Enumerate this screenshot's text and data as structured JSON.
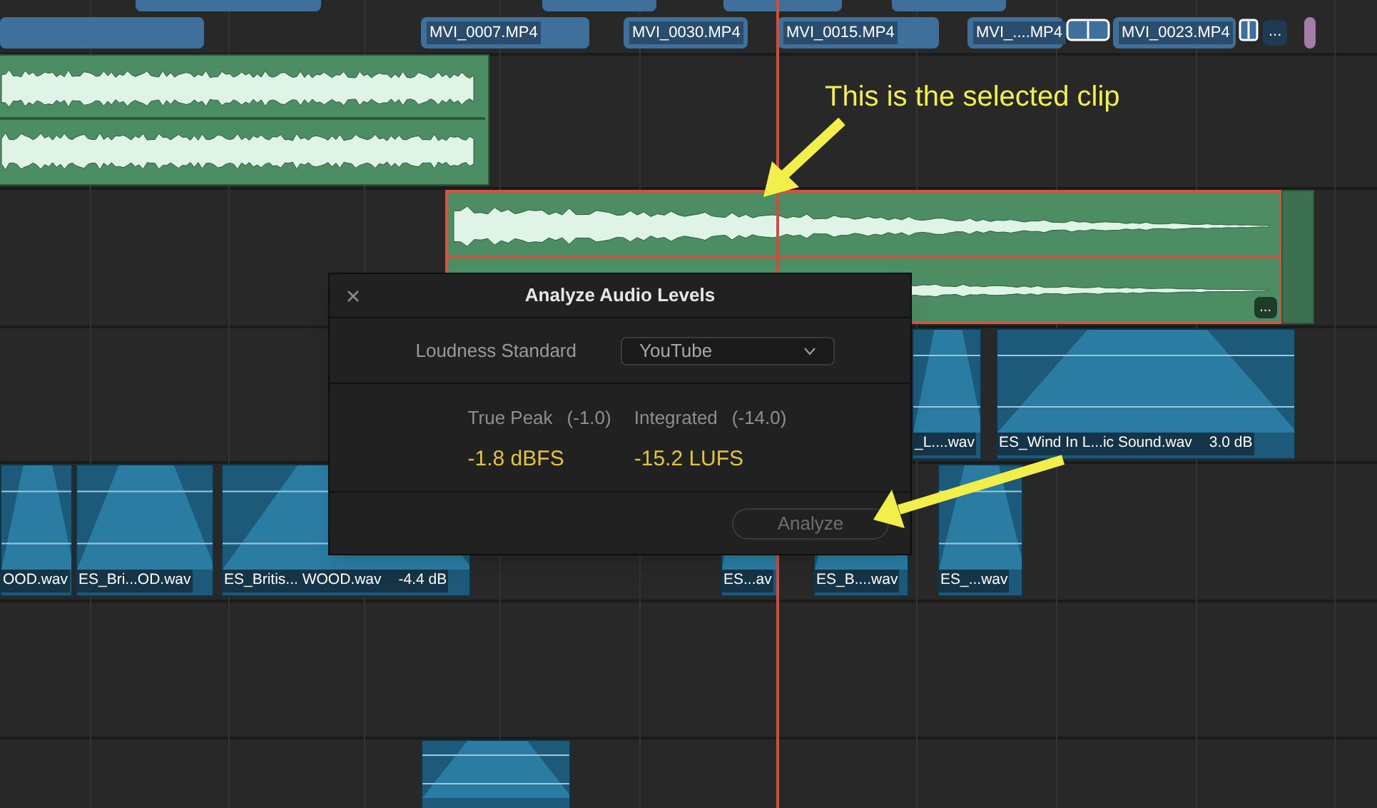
{
  "video_track": {
    "clips": [
      {
        "label": "MVI_0007.MP4"
      },
      {
        "label": "MVI_0030.MP4"
      },
      {
        "label": "MVI_0015.MP4"
      },
      {
        "label": "MVI_....MP4"
      },
      {
        "label": "MVI_0023.MP4"
      }
    ],
    "more_marker": "..."
  },
  "green_clips": [
    {
      "selected": false
    },
    {
      "selected": true,
      "more_marker": "..."
    }
  ],
  "audio_clips": [
    {
      "label": "_L....wav"
    },
    {
      "label": "ES_Wind In L...ic Sound.wav",
      "gain": "3.0 dB"
    },
    {
      "label": "OOD.wav"
    },
    {
      "label": "ES_Bri...OD.wav"
    },
    {
      "label": "ES_Britis... WOOD.wav",
      "gain": "-4.4 dB"
    },
    {
      "label": "ES...av"
    },
    {
      "label": "ES_B....wav"
    },
    {
      "label": "ES_...wav"
    }
  ],
  "dialog": {
    "title": "Analyze Audio Levels",
    "loudness_standard": {
      "label": "Loudness Standard",
      "value": "YouTube"
    },
    "metrics": [
      {
        "label": "True Peak",
        "target": "(-1.0)",
        "reading": "-1.8 dBFS"
      },
      {
        "label": "Integrated",
        "target": "(-14.0)",
        "reading": "-15.2 LUFS"
      }
    ],
    "button": {
      "label": "Analyze",
      "disabled": true
    }
  },
  "annotation": "This is the selected clip"
}
